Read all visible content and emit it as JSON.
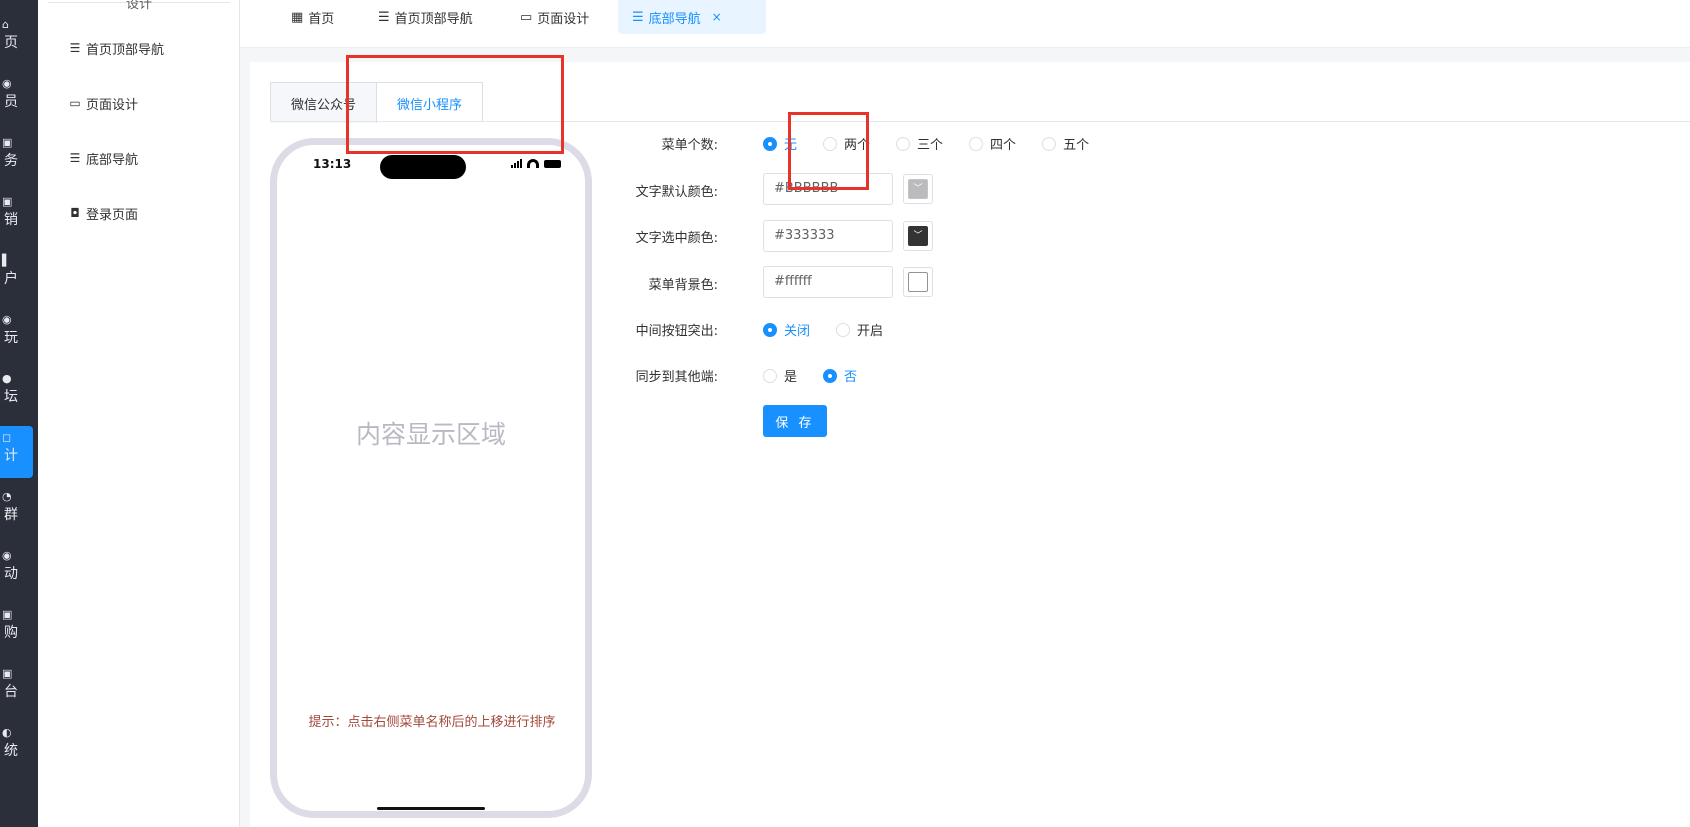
{
  "leftbar": {
    "items": [
      {
        "icon": "⌂",
        "label": "页"
      },
      {
        "icon": "◉",
        "label": "员"
      },
      {
        "icon": "▣",
        "label": "务"
      },
      {
        "icon": "▣",
        "label": "销"
      },
      {
        "icon": "▌",
        "label": "户"
      },
      {
        "icon": "◉",
        "label": "玩"
      },
      {
        "icon": "●",
        "label": "坛"
      },
      {
        "icon": "◻",
        "label": "计"
      },
      {
        "icon": "◔",
        "label": "群"
      },
      {
        "icon": "◉",
        "label": "动"
      },
      {
        "icon": "▣",
        "label": "购"
      },
      {
        "icon": "▣",
        "label": "台"
      },
      {
        "icon": "◐",
        "label": "统"
      }
    ]
  },
  "submenu": {
    "title": "设计",
    "items": [
      {
        "icon": "☰",
        "label": "首页顶部导航"
      },
      {
        "icon": "▭",
        "label": "页面设计"
      },
      {
        "icon": "☰",
        "label": "底部导航"
      },
      {
        "icon": "◘",
        "label": "登录页面"
      }
    ]
  },
  "tabbar": {
    "tabs": [
      {
        "icon": "▦",
        "label": "首页"
      },
      {
        "icon": "☰",
        "label": "首页顶部导航"
      },
      {
        "icon": "▭",
        "label": "页面设计"
      },
      {
        "icon": "☰",
        "label": "底部导航",
        "close": "×"
      }
    ]
  },
  "panel_tabs": [
    "微信公众号",
    "微信小程序"
  ],
  "phone": {
    "time": "13:13",
    "content": "内容显示区域",
    "hint": "提示：点击右侧菜单名称后的上移进行排序"
  },
  "form": {
    "menu_count": {
      "label": "菜单个数:",
      "options": [
        "无",
        "两个",
        "三个",
        "四个",
        "五个"
      ],
      "selected": "无"
    },
    "text_default_color": {
      "label": "文字默认颜色:",
      "value": "#BBBBBB"
    },
    "text_selected_color": {
      "label": "文字选中颜色:",
      "value": "#333333"
    },
    "menu_bg_color": {
      "label": "菜单背景色:",
      "value": "#ffffff"
    },
    "middle_button": {
      "label": "中间按钮突出:",
      "options": [
        "关闭",
        "开启"
      ],
      "selected": "关闭"
    },
    "sync": {
      "label": "同步到其他端:",
      "options": [
        "是",
        "否"
      ],
      "selected": "否"
    },
    "save_label": "保 存"
  },
  "colors": {
    "accent": "#1890ff",
    "highlight_box": "#e8332a",
    "swatch_default": "#bbbbbb",
    "swatch_selected": "#333333",
    "swatch_bg": "#ffffff"
  }
}
